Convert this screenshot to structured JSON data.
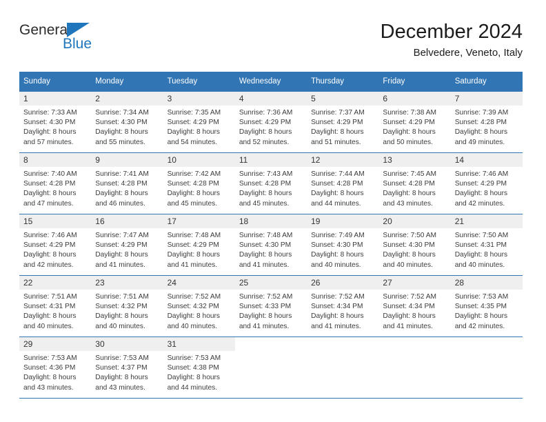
{
  "brand": {
    "name_top": "General",
    "name_bottom": "Blue",
    "triangle_color": "#1f76bc",
    "text_color": "#2b2b2b"
  },
  "header": {
    "title": "December 2024",
    "location": "Belvedere, Veneto, Italy"
  },
  "theme": {
    "header_blue": "#3175b4",
    "daynum_bg": "#efefef",
    "text": "#333333"
  },
  "calendar": {
    "weekday_headers": [
      "Sunday",
      "Monday",
      "Tuesday",
      "Wednesday",
      "Thursday",
      "Friday",
      "Saturday"
    ],
    "weeks": [
      [
        {
          "day": "1",
          "sunrise": "Sunrise: 7:33 AM",
          "sunset": "Sunset: 4:30 PM",
          "daylight_line1": "Daylight: 8 hours",
          "daylight_line2": "and 57 minutes."
        },
        {
          "day": "2",
          "sunrise": "Sunrise: 7:34 AM",
          "sunset": "Sunset: 4:30 PM",
          "daylight_line1": "Daylight: 8 hours",
          "daylight_line2": "and 55 minutes."
        },
        {
          "day": "3",
          "sunrise": "Sunrise: 7:35 AM",
          "sunset": "Sunset: 4:29 PM",
          "daylight_line1": "Daylight: 8 hours",
          "daylight_line2": "and 54 minutes."
        },
        {
          "day": "4",
          "sunrise": "Sunrise: 7:36 AM",
          "sunset": "Sunset: 4:29 PM",
          "daylight_line1": "Daylight: 8 hours",
          "daylight_line2": "and 52 minutes."
        },
        {
          "day": "5",
          "sunrise": "Sunrise: 7:37 AM",
          "sunset": "Sunset: 4:29 PM",
          "daylight_line1": "Daylight: 8 hours",
          "daylight_line2": "and 51 minutes."
        },
        {
          "day": "6",
          "sunrise": "Sunrise: 7:38 AM",
          "sunset": "Sunset: 4:29 PM",
          "daylight_line1": "Daylight: 8 hours",
          "daylight_line2": "and 50 minutes."
        },
        {
          "day": "7",
          "sunrise": "Sunrise: 7:39 AM",
          "sunset": "Sunset: 4:28 PM",
          "daylight_line1": "Daylight: 8 hours",
          "daylight_line2": "and 49 minutes."
        }
      ],
      [
        {
          "day": "8",
          "sunrise": "Sunrise: 7:40 AM",
          "sunset": "Sunset: 4:28 PM",
          "daylight_line1": "Daylight: 8 hours",
          "daylight_line2": "and 47 minutes."
        },
        {
          "day": "9",
          "sunrise": "Sunrise: 7:41 AM",
          "sunset": "Sunset: 4:28 PM",
          "daylight_line1": "Daylight: 8 hours",
          "daylight_line2": "and 46 minutes."
        },
        {
          "day": "10",
          "sunrise": "Sunrise: 7:42 AM",
          "sunset": "Sunset: 4:28 PM",
          "daylight_line1": "Daylight: 8 hours",
          "daylight_line2": "and 45 minutes."
        },
        {
          "day": "11",
          "sunrise": "Sunrise: 7:43 AM",
          "sunset": "Sunset: 4:28 PM",
          "daylight_line1": "Daylight: 8 hours",
          "daylight_line2": "and 45 minutes."
        },
        {
          "day": "12",
          "sunrise": "Sunrise: 7:44 AM",
          "sunset": "Sunset: 4:28 PM",
          "daylight_line1": "Daylight: 8 hours",
          "daylight_line2": "and 44 minutes."
        },
        {
          "day": "13",
          "sunrise": "Sunrise: 7:45 AM",
          "sunset": "Sunset: 4:28 PM",
          "daylight_line1": "Daylight: 8 hours",
          "daylight_line2": "and 43 minutes."
        },
        {
          "day": "14",
          "sunrise": "Sunrise: 7:46 AM",
          "sunset": "Sunset: 4:29 PM",
          "daylight_line1": "Daylight: 8 hours",
          "daylight_line2": "and 42 minutes."
        }
      ],
      [
        {
          "day": "15",
          "sunrise": "Sunrise: 7:46 AM",
          "sunset": "Sunset: 4:29 PM",
          "daylight_line1": "Daylight: 8 hours",
          "daylight_line2": "and 42 minutes."
        },
        {
          "day": "16",
          "sunrise": "Sunrise: 7:47 AM",
          "sunset": "Sunset: 4:29 PM",
          "daylight_line1": "Daylight: 8 hours",
          "daylight_line2": "and 41 minutes."
        },
        {
          "day": "17",
          "sunrise": "Sunrise: 7:48 AM",
          "sunset": "Sunset: 4:29 PM",
          "daylight_line1": "Daylight: 8 hours",
          "daylight_line2": "and 41 minutes."
        },
        {
          "day": "18",
          "sunrise": "Sunrise: 7:48 AM",
          "sunset": "Sunset: 4:30 PM",
          "daylight_line1": "Daylight: 8 hours",
          "daylight_line2": "and 41 minutes."
        },
        {
          "day": "19",
          "sunrise": "Sunrise: 7:49 AM",
          "sunset": "Sunset: 4:30 PM",
          "daylight_line1": "Daylight: 8 hours",
          "daylight_line2": "and 40 minutes."
        },
        {
          "day": "20",
          "sunrise": "Sunrise: 7:50 AM",
          "sunset": "Sunset: 4:30 PM",
          "daylight_line1": "Daylight: 8 hours",
          "daylight_line2": "and 40 minutes."
        },
        {
          "day": "21",
          "sunrise": "Sunrise: 7:50 AM",
          "sunset": "Sunset: 4:31 PM",
          "daylight_line1": "Daylight: 8 hours",
          "daylight_line2": "and 40 minutes."
        }
      ],
      [
        {
          "day": "22",
          "sunrise": "Sunrise: 7:51 AM",
          "sunset": "Sunset: 4:31 PM",
          "daylight_line1": "Daylight: 8 hours",
          "daylight_line2": "and 40 minutes."
        },
        {
          "day": "23",
          "sunrise": "Sunrise: 7:51 AM",
          "sunset": "Sunset: 4:32 PM",
          "daylight_line1": "Daylight: 8 hours",
          "daylight_line2": "and 40 minutes."
        },
        {
          "day": "24",
          "sunrise": "Sunrise: 7:52 AM",
          "sunset": "Sunset: 4:32 PM",
          "daylight_line1": "Daylight: 8 hours",
          "daylight_line2": "and 40 minutes."
        },
        {
          "day": "25",
          "sunrise": "Sunrise: 7:52 AM",
          "sunset": "Sunset: 4:33 PM",
          "daylight_line1": "Daylight: 8 hours",
          "daylight_line2": "and 41 minutes."
        },
        {
          "day": "26",
          "sunrise": "Sunrise: 7:52 AM",
          "sunset": "Sunset: 4:34 PM",
          "daylight_line1": "Daylight: 8 hours",
          "daylight_line2": "and 41 minutes."
        },
        {
          "day": "27",
          "sunrise": "Sunrise: 7:52 AM",
          "sunset": "Sunset: 4:34 PM",
          "daylight_line1": "Daylight: 8 hours",
          "daylight_line2": "and 41 minutes."
        },
        {
          "day": "28",
          "sunrise": "Sunrise: 7:53 AM",
          "sunset": "Sunset: 4:35 PM",
          "daylight_line1": "Daylight: 8 hours",
          "daylight_line2": "and 42 minutes."
        }
      ],
      [
        {
          "day": "29",
          "sunrise": "Sunrise: 7:53 AM",
          "sunset": "Sunset: 4:36 PM",
          "daylight_line1": "Daylight: 8 hours",
          "daylight_line2": "and 43 minutes."
        },
        {
          "day": "30",
          "sunrise": "Sunrise: 7:53 AM",
          "sunset": "Sunset: 4:37 PM",
          "daylight_line1": "Daylight: 8 hours",
          "daylight_line2": "and 43 minutes."
        },
        {
          "day": "31",
          "sunrise": "Sunrise: 7:53 AM",
          "sunset": "Sunset: 4:38 PM",
          "daylight_line1": "Daylight: 8 hours",
          "daylight_line2": "and 44 minutes."
        },
        {
          "day": "",
          "sunrise": "",
          "sunset": "",
          "daylight_line1": "",
          "daylight_line2": ""
        },
        {
          "day": "",
          "sunrise": "",
          "sunset": "",
          "daylight_line1": "",
          "daylight_line2": ""
        },
        {
          "day": "",
          "sunrise": "",
          "sunset": "",
          "daylight_line1": "",
          "daylight_line2": ""
        },
        {
          "day": "",
          "sunrise": "",
          "sunset": "",
          "daylight_line1": "",
          "daylight_line2": ""
        }
      ]
    ]
  }
}
